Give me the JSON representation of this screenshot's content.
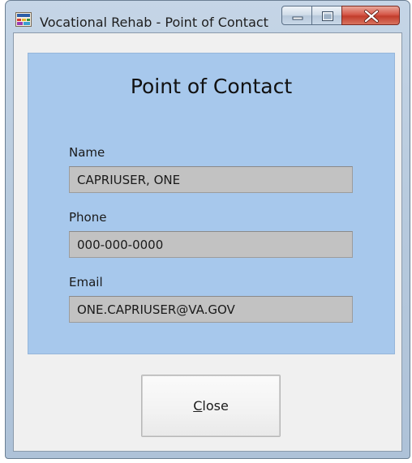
{
  "window": {
    "title": "Vocational Rehab - Point of Contact",
    "caption_buttons": {
      "minimize_icon": "minimize-icon",
      "maximize_icon": "maximize-icon",
      "close_icon": "close-icon"
    }
  },
  "panel": {
    "title": "Point of Contact",
    "background_color": "#a7c8ec",
    "fields": [
      {
        "label": "Name",
        "value": "CAPRIUSER, ONE"
      },
      {
        "label": "Phone",
        "value": "000-000-0000"
      },
      {
        "label": "Email",
        "value": "ONE.CAPRIUSER@VA.GOV"
      }
    ]
  },
  "footer": {
    "close_mnemonic": "C",
    "close_rest": "lose"
  }
}
